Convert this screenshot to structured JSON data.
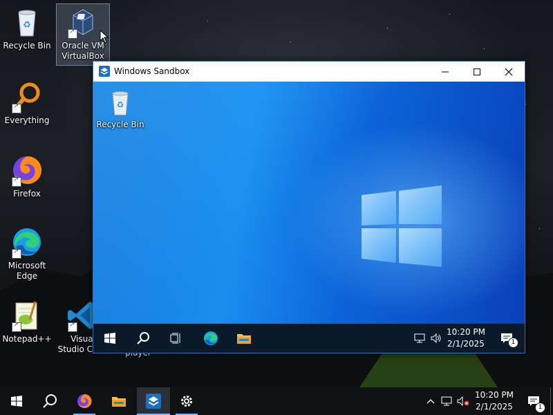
{
  "desktop": {
    "icons": [
      {
        "label": "Recycle Bin",
        "icon": "recycle-bin-icon"
      },
      {
        "label": "Oracle VM VirtualBox",
        "icon": "virtualbox-icon"
      },
      {
        "label": "Everything",
        "icon": "everything-search-icon"
      },
      {
        "label": "Firefox",
        "icon": "firefox-icon"
      },
      {
        "label": "Microsoft Edge",
        "icon": "edge-icon"
      },
      {
        "label": "Notepad++",
        "icon": "notepad-plus-plus-icon"
      },
      {
        "label": "Visual Studio Code",
        "icon": "vscode-icon"
      },
      {
        "label": "player",
        "icon": "media-player-icon"
      }
    ]
  },
  "sandbox": {
    "title": "Windows Sandbox",
    "desktop_icons": [
      {
        "label": "Recycle Bin",
        "icon": "recycle-bin-icon"
      }
    ],
    "taskbar": {
      "items": [
        "start",
        "search",
        "task-view",
        "edge",
        "file-explorer"
      ],
      "time": "10:20 PM",
      "date": "2/1/2025",
      "notification_count": "1"
    }
  },
  "taskbar": {
    "items": [
      "start",
      "search",
      "firefox",
      "file-explorer",
      "windows-sandbox",
      "settings"
    ],
    "active": "windows-sandbox",
    "time": "10:20 PM",
    "date": "2/1/2025",
    "notification_count": "1"
  },
  "colors": {
    "accent": "#0078d7",
    "sandbox_wallpaper": "#1477d9",
    "taskbar": "#0f1113"
  }
}
